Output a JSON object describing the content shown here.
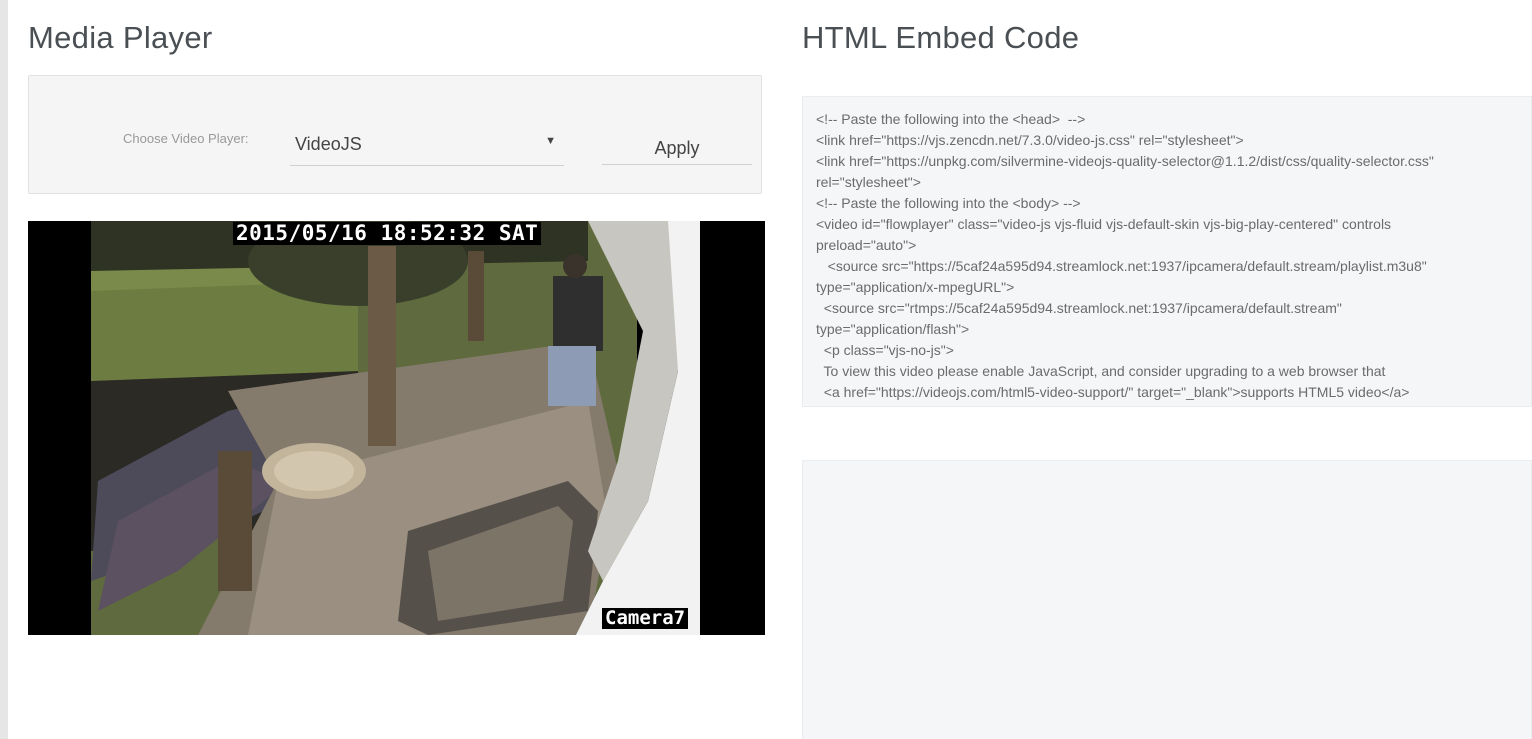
{
  "media_player": {
    "title": "Media Player",
    "choose_label": "Choose Video Player:",
    "selected_player": "VideoJS",
    "select_arrow": "▼",
    "apply_label": "Apply"
  },
  "video": {
    "timestamp": "2015/05/16 18:52:32 SAT",
    "camera_label": "Camera7"
  },
  "embed": {
    "title": "HTML Embed Code",
    "code_lines": [
      "<!-- Paste the following into the <head>  -->",
      "<link href=\"https://vjs.zencdn.net/7.3.0/video-js.css\" rel=\"stylesheet\">",
      "<link href=\"https://unpkg.com/silvermine-videojs-quality-selector@1.1.2/dist/css/quality-selector.css\"",
      "rel=\"stylesheet\">",
      "<!-- Paste the following into the <body> -->",
      "<video id=\"flowplayer\" class=\"video-js vjs-fluid vjs-default-skin vjs-big-play-centered\" controls",
      "preload=\"auto\">",
      "   <source src=\"https://5caf24a595d94.streamlock.net:1937/ipcamera/default.stream/playlist.m3u8\"",
      "type=\"application/x-mpegURL\">",
      "  <source src=\"rtmps://5caf24a595d94.streamlock.net:1937/ipcamera/default.stream\"",
      "type=\"application/flash\">",
      "  <p class=\"vjs-no-js\">",
      "  To view this video please enable JavaScript, and consider upgrading to a web browser that",
      "  <a href=\"https://videojs.com/html5-video-support/\" target=\"_blank\">supports HTML5 video</a>"
    ]
  }
}
